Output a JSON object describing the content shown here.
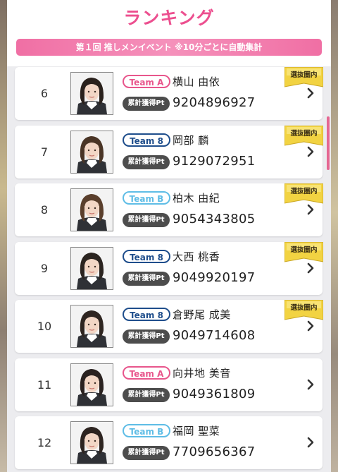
{
  "title": "ランキング",
  "banner": "第１回 推しメンイベント ※10分ごとに自動集計",
  "points_label": "累計獲得Pt",
  "badge_label": "選抜圏内",
  "colors": {
    "accent_pink": "#ec4f8f",
    "team_a": "#e8568c",
    "team_8": "#1f4e8c",
    "team_b": "#5fbde6",
    "badge_gold": "#f4d84a"
  },
  "rows": [
    {
      "rank": "6",
      "team": "Team A",
      "name": "横山 由依",
      "points": "9204896927",
      "selected": true
    },
    {
      "rank": "7",
      "team": "Team 8",
      "name": "岡部 麟",
      "points": "9129072951",
      "selected": true
    },
    {
      "rank": "8",
      "team": "Team B",
      "name": "柏木 由紀",
      "points": "9054343805",
      "selected": true
    },
    {
      "rank": "9",
      "team": "Team 8",
      "name": "大西 桃香",
      "points": "9049920197",
      "selected": true
    },
    {
      "rank": "10",
      "team": "Team 8",
      "name": "倉野尾 成美",
      "points": "9049714608",
      "selected": true
    },
    {
      "rank": "11",
      "team": "Team A",
      "name": "向井地 美音",
      "points": "9049361809",
      "selected": false
    },
    {
      "rank": "12",
      "team": "Team B",
      "name": "福岡 聖菜",
      "points": "7709656367",
      "selected": false
    }
  ]
}
